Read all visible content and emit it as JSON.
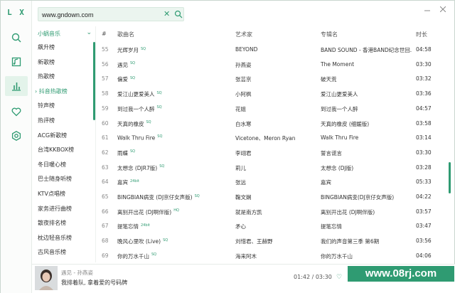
{
  "app": {
    "logo": "L X"
  },
  "search": {
    "value": "www.gndown.com",
    "placeholder": ""
  },
  "categories": {
    "header": "小蜗音乐",
    "items": [
      "飙升榜",
      "新歌榜",
      "热歌榜",
      "抖音热歌榜",
      "铃声榜",
      "热评榜",
      "ACG新歌榜",
      "台湾KKBOX榜",
      "冬日暖心榜",
      "巴士随身听榜",
      "KTV点唱榜",
      "家务进行曲榜",
      "散夜排名榜",
      "枕边轻音乐榜",
      "古风音乐榜"
    ],
    "active_index": 3
  },
  "table": {
    "headers": {
      "num": "#",
      "title": "歌曲名",
      "artist": "艺术家",
      "album": "专辑名",
      "time": "时长"
    },
    "rows": [
      {
        "num": "55",
        "title": "光辉岁月",
        "tag": "SQ",
        "artist": "BEYOND",
        "album": "BAND SOUND - 香港BAND纪念世回...",
        "time": "04:58"
      },
      {
        "num": "56",
        "title": "遇见",
        "tag": "SQ",
        "artist": "孙燕姿",
        "album": "The Moment",
        "time": "03:30"
      },
      {
        "num": "57",
        "title": "偏爱",
        "tag": "SQ",
        "artist": "张芸京",
        "album": "破天荒",
        "time": "03:32"
      },
      {
        "num": "58",
        "title": "爱江山更爱美人",
        "tag": "SQ",
        "artist": "小阿枫",
        "album": "爱江山更爱美人",
        "time": "03:36"
      },
      {
        "num": "59",
        "title": "到过我一个人醉",
        "tag": "SQ",
        "artist": "花姐",
        "album": "到过我一个人醉",
        "time": "04:57"
      },
      {
        "num": "60",
        "title": "天真的橡皮",
        "tag": "SQ",
        "artist": "白水寒",
        "album": "天真的橡皮 (细媛版)",
        "time": "03:58"
      },
      {
        "num": "61",
        "title": "Walk Thru Fire",
        "tag": "SQ",
        "artist": "Vicetone、Meron Ryan",
        "album": "Walk Thru Fire",
        "time": "03:14"
      },
      {
        "num": "62",
        "title": "雨蝶",
        "tag": "SQ",
        "artist": "李翊君",
        "album": "誓言谎言",
        "time": "03:30"
      },
      {
        "num": "63",
        "title": "太想念 (DJR7版)",
        "tag": "SQ",
        "artist": "莉儿",
        "album": "太想念 (DJ版)",
        "time": "03:28"
      },
      {
        "num": "64",
        "title": "嘉宾",
        "tag": "24bit",
        "artist": "张远",
        "album": "嘉宾",
        "time": "05:33"
      },
      {
        "num": "65",
        "title": "BINGBIAN病变 (DJ京仔女声版)",
        "tag": "SQ",
        "artist": "鞠文娴",
        "album": "BINGBIAN病变(DJ京仔女声版)",
        "time": "04:22"
      },
      {
        "num": "66",
        "title": "离别开出花 (DJ啊伴版)",
        "tag": "HQ",
        "artist": "就是南方凯",
        "album": "离别开出花 (DJ啊伴版)",
        "time": "03:57"
      },
      {
        "num": "67",
        "title": "提笔忘情",
        "tag": "24bit",
        "artist": "矛心",
        "album": "提笔忘情",
        "time": "03:47"
      },
      {
        "num": "68",
        "title": "晚风心里吹 (Live)",
        "tag": "SQ",
        "artist": "刘惜君、王赫野",
        "album": "我们的声音第三季 第6期",
        "time": "03:56"
      },
      {
        "num": "69",
        "title": "你的万水千山",
        "tag": "SQ",
        "artist": "海来阿木",
        "album": "你的万水千山",
        "time": "04:06"
      }
    ]
  },
  "player": {
    "song": "遇见 - 孙燕姿",
    "lyric": "我排着队, 拿着爱的号码牌",
    "progress": "01:42 / 03:30",
    "progress_fraction": 0.486
  },
  "watermark": "www.08rj.com",
  "colors": {
    "accent": "#2f9b72",
    "accent_light": "#e3f3ea"
  }
}
